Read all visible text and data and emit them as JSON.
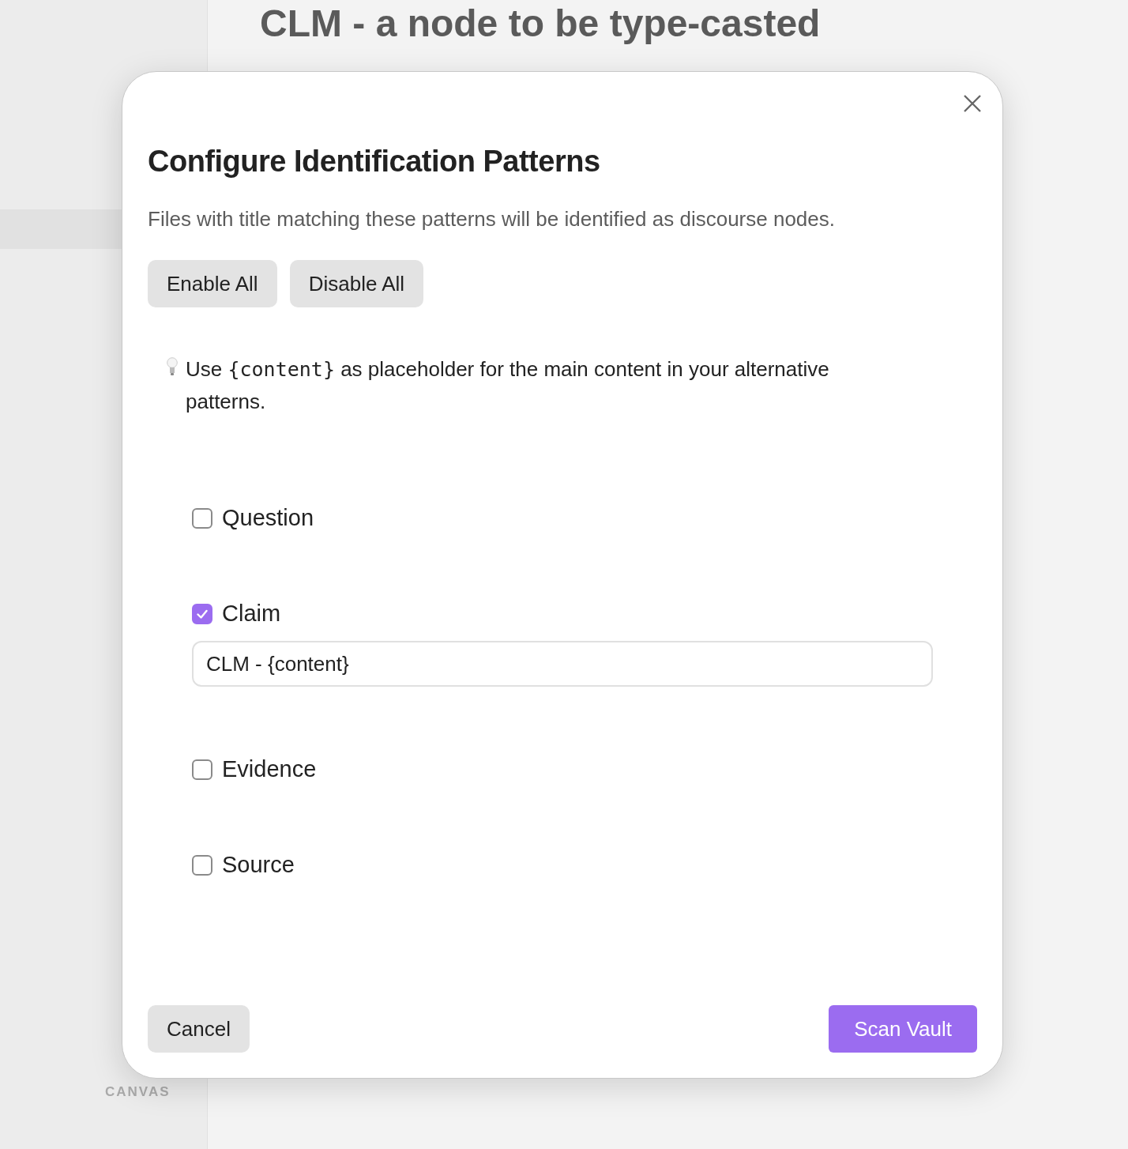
{
  "background": {
    "page_title": "CLM - a node to be type-casted",
    "sidebar_label": "CANVAS"
  },
  "dialog": {
    "title": "Configure Identification Patterns",
    "description": "Files with title matching these patterns will be identified as discourse nodes.",
    "bulk_buttons": [
      "Enable All",
      "Disable All"
    ],
    "hint": {
      "before": "Use",
      "code": "{content}",
      "after": "as placeholder for the main content in your alternative patterns."
    },
    "patterns": [
      {
        "label": "Question",
        "checked": false
      },
      {
        "label": "Claim",
        "checked": true,
        "value": "CLM - {content}"
      },
      {
        "label": "Evidence",
        "checked": false
      },
      {
        "label": "Source",
        "checked": false
      }
    ],
    "cancel": "Cancel",
    "confirm": "Scan Vault"
  }
}
